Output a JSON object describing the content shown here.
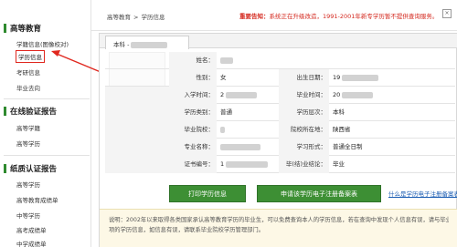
{
  "sidebar": {
    "sections": [
      {
        "title": "高等教育",
        "items": [
          {
            "label": "学籍信息(图像校对)",
            "active": false
          },
          {
            "label": "学历信息",
            "active": true
          },
          {
            "label": "考研信息",
            "active": false
          },
          {
            "label": "毕业去向",
            "active": false
          }
        ]
      },
      {
        "title": "在线验证报告",
        "items": [
          {
            "label": "高等学籍",
            "active": false
          },
          {
            "label": "高等学历",
            "active": false
          }
        ]
      },
      {
        "title": "纸质认证报告",
        "items": [
          {
            "label": "高等学历",
            "active": false
          },
          {
            "label": "高等教育成绩单",
            "active": false
          },
          {
            "label": "中等学历",
            "active": false
          },
          {
            "label": "高考成绩单",
            "active": false
          },
          {
            "label": "中学成绩单",
            "active": false
          }
        ]
      }
    ]
  },
  "header": {
    "breadcrumb": [
      "高等教育",
      "学历信息"
    ],
    "breadcrumb_separator": ">",
    "notice_label": "重要告知：",
    "notice_text": "系统正在升级改造，1991-2001年新专学历暂不提供查询服务。"
  },
  "panel": {
    "tab_label": "本科 - ",
    "fields": {
      "name_label": "姓名：",
      "gender_label": "性别：",
      "gender_value": "女",
      "birth_label": "出生日期：",
      "birth_value": "19",
      "enroll_label": "入学时间：",
      "enroll_value": "2",
      "grad_label": "毕业时间：",
      "grad_value": "20",
      "type_label": "学历类别：",
      "type_value": "普通",
      "level_label": "学历层次：",
      "level_value": "本科",
      "school_label": "毕业院校：",
      "school_value": "",
      "location_label": "院校所在地：",
      "location_value": "陕西省",
      "major_label": "专业名称：",
      "major_value": "",
      "form_label": "学习形式：",
      "form_value": "普通全日制",
      "cert_label": "证书编号：",
      "cert_value": "1",
      "conclusion_label": "毕(结)业结论：",
      "conclusion_value": "毕业"
    },
    "print_button": "打印学历信息",
    "apply_button": "申请该学历电子注册备案表",
    "help_link": "什么是学历电子注册备案表",
    "note_line1": "说明：2002年以来取得各类国家承认高等教育学历的毕业生，可以免费查询本人的学历信息，若在查询中发现个人信息有误，请与毕业院校学历管理部门联系，",
    "note_line2": "项的学历信息，如信息有误，请联系毕业院校学历管理部门。"
  },
  "colors": {
    "sidebar_accent": "#2f8a2f",
    "active_border": "#e0271e",
    "notice": "#d4281e",
    "button": "#3d8f34",
    "link": "#1e5fb4"
  }
}
